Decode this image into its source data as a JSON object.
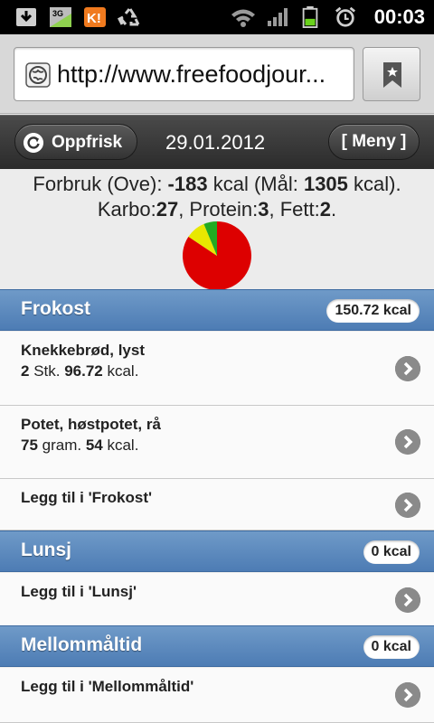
{
  "status_bar": {
    "time": "00:03",
    "network": "3G",
    "icons": [
      "download-icon",
      "sim-3g-icon",
      "app-k1-icon",
      "recycle-icon",
      "wifi-icon",
      "signal-icon",
      "battery-icon",
      "alarm-icon"
    ]
  },
  "browser": {
    "url": "http://www.freefoodjour..."
  },
  "header": {
    "refresh_label": "Oppfrisk",
    "date": "29.01.2012",
    "menu_label": "[ Meny ]"
  },
  "summary": {
    "line1_prefix": "Forbruk (Ove): ",
    "consumption": "-183",
    "line1_mid": " kcal (Mål: ",
    "goal": "1305",
    "line1_suffix": " kcal).",
    "carb_label": "Karbo:",
    "carb": "27",
    "protein_label": ", Protein:",
    "protein": "3",
    "fat_label": ", Fett:",
    "fat": "2",
    "fat_suffix": "."
  },
  "chart_data": {
    "type": "pie",
    "slices": [
      {
        "label": "Karbo",
        "value": 27,
        "color": "#dd0000"
      },
      {
        "label": "Protein",
        "value": 3,
        "color": "#e8e800"
      },
      {
        "label": "Fett",
        "value": 2,
        "color": "#22aa22"
      }
    ]
  },
  "meals": [
    {
      "name": "Frokost",
      "kcal": "150.72 kcal",
      "items": [
        {
          "title": "Knekkebrød, lyst",
          "qty": "2",
          "unit": " Stk. ",
          "kcal": "96.72",
          "kcal_unit": " kcal."
        },
        {
          "title": "Potet, høstpotet, rå",
          "qty": "75",
          "unit": " gram. ",
          "kcal": "54",
          "kcal_unit": " kcal."
        }
      ],
      "add_label": "Legg til i 'Frokost'"
    },
    {
      "name": "Lunsj",
      "kcal": "0 kcal",
      "items": [],
      "add_label": "Legg til i 'Lunsj'"
    },
    {
      "name": "Mellommåltid",
      "kcal": "0 kcal",
      "items": [],
      "add_label": "Legg til i 'Mellommåltid'"
    }
  ],
  "colors": {
    "section_header": "#5a86bd",
    "pie_carb": "#dd0000",
    "pie_protein": "#e8e800",
    "pie_fat": "#22aa22"
  }
}
